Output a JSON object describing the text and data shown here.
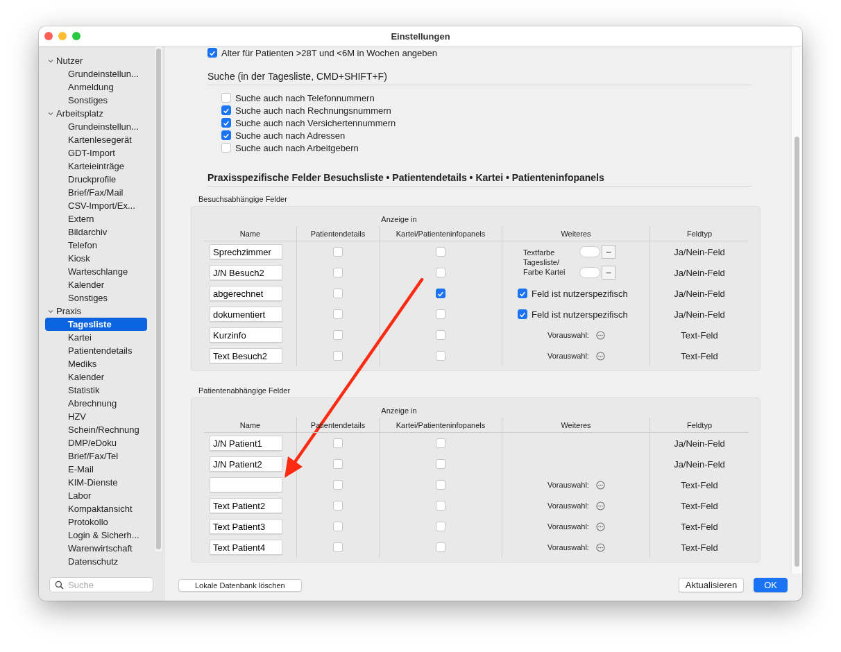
{
  "window": {
    "title": "Einstellungen"
  },
  "sidebar": {
    "items": [
      {
        "label": "Nutzer",
        "expanded": true,
        "selected": false,
        "children": [
          {
            "label": "Grundeinstellun...",
            "selected": false
          },
          {
            "label": "Anmeldung",
            "selected": false
          },
          {
            "label": "Sonstiges",
            "selected": false
          }
        ]
      },
      {
        "label": "Arbeitsplatz",
        "expanded": true,
        "selected": false,
        "children": [
          {
            "label": "Grundeinstellun...",
            "selected": false
          },
          {
            "label": "Kartenlesegerät",
            "selected": false
          },
          {
            "label": "GDT-Import",
            "selected": false
          },
          {
            "label": "Karteieinträge",
            "selected": false
          },
          {
            "label": "Druckprofile",
            "selected": false
          },
          {
            "label": "Brief/Fax/Mail",
            "selected": false
          },
          {
            "label": "CSV-Import/Ex...",
            "selected": false
          },
          {
            "label": "Extern",
            "selected": false
          },
          {
            "label": "Bildarchiv",
            "selected": false
          },
          {
            "label": "Telefon",
            "selected": false
          },
          {
            "label": "Kiosk",
            "selected": false
          },
          {
            "label": "Warteschlange",
            "selected": false
          },
          {
            "label": "Kalender",
            "selected": false
          },
          {
            "label": "Sonstiges",
            "selected": false
          }
        ]
      },
      {
        "label": "Praxis",
        "expanded": true,
        "selected": false,
        "children": [
          {
            "label": "Tagesliste",
            "selected": true
          },
          {
            "label": "Kartei",
            "selected": false
          },
          {
            "label": "Patientendetails",
            "selected": false
          },
          {
            "label": "Mediks",
            "selected": false
          },
          {
            "label": "Kalender",
            "selected": false
          },
          {
            "label": "Statistik",
            "selected": false
          },
          {
            "label": "Abrechnung",
            "selected": false
          },
          {
            "label": "HZV",
            "selected": false
          },
          {
            "label": "Schein/Rechnung",
            "selected": false
          },
          {
            "label": "DMP/eDoku",
            "selected": false
          },
          {
            "label": "Brief/Fax/Tel",
            "selected": false
          },
          {
            "label": "E-Mail",
            "selected": false
          },
          {
            "label": "KIM-Dienste",
            "selected": false
          },
          {
            "label": "Labor",
            "selected": false
          },
          {
            "label": "Kompaktansicht",
            "selected": false
          },
          {
            "label": "Protokollo",
            "selected": false
          },
          {
            "label": "Login & Sicherh...",
            "selected": false
          },
          {
            "label": "Warenwirtschaft",
            "selected": false
          },
          {
            "label": "Datenschutz",
            "selected": false
          }
        ]
      }
    ],
    "search": {
      "placeholder": "Suche"
    }
  },
  "top_option": {
    "label": "Alter für Patienten >28T und <6M in Wochen angeben",
    "checked": true
  },
  "search_section": {
    "title": "Suche (in der Tagesliste, CMD+SHIFT+F)",
    "options": [
      {
        "label": "Suche auch nach Telefonnummern",
        "checked": false
      },
      {
        "label": "Suche auch nach Rechnungsnummern",
        "checked": true
      },
      {
        "label": "Suche auch nach Versichertennummern",
        "checked": true
      },
      {
        "label": "Suche auch nach Adressen",
        "checked": true
      },
      {
        "label": "Suche auch nach Arbeitgebern",
        "checked": false
      }
    ]
  },
  "fields_section": {
    "title": "Praxisspezifische Felder Besuchsliste • Patientendetails • Kartei • Patienteninfopanels",
    "groups": [
      {
        "title": "Besuchsabhängige Felder",
        "group_header": "Anzeige in",
        "columns": [
          "Name",
          "Patientendetails",
          "Kartei/Patienteninfopanels",
          "Weiteres",
          "Feldtyp"
        ],
        "color_label": "Textfarbe Tagesliste/ Farbe Kartei",
        "rows": [
          {
            "name": "Sprechzimmer",
            "patientendetails": false,
            "kartei": false,
            "extra": {
              "kind": "color",
              "button": "–"
            },
            "type": "Ja/Nein-Feld"
          },
          {
            "name": "J/N Besuch2",
            "patientendetails": false,
            "kartei": false,
            "extra": {
              "kind": "color",
              "button": "–"
            },
            "type": "Ja/Nein-Feld"
          },
          {
            "name": "abgerechnet",
            "patientendetails": false,
            "kartei": true,
            "extra": {
              "kind": "checkbox",
              "label": "Feld ist nutzerspezifisch",
              "checked": true
            },
            "type": "Ja/Nein-Feld"
          },
          {
            "name": "dokumentiert",
            "patientendetails": false,
            "kartei": false,
            "extra": {
              "kind": "checkbox",
              "label": "Feld ist nutzerspezifisch",
              "checked": true
            },
            "type": "Ja/Nein-Feld"
          },
          {
            "name": "Kurzinfo",
            "patientendetails": false,
            "kartei": false,
            "extra": {
              "kind": "preselect",
              "label": "Vorauswahl:"
            },
            "type": "Text-Feld"
          },
          {
            "name": "Text Besuch2",
            "patientendetails": false,
            "kartei": false,
            "extra": {
              "kind": "preselect",
              "label": "Vorauswahl:"
            },
            "type": "Text-Feld"
          }
        ]
      },
      {
        "title": "Patientenabhängige Felder",
        "group_header": "Anzeige in",
        "columns": [
          "Name",
          "Patientendetails",
          "Kartei/Patienteninfopanels",
          "Weiteres",
          "Feldtyp"
        ],
        "rows": [
          {
            "name": "J/N Patient1",
            "patientendetails": false,
            "kartei": false,
            "extra": {
              "kind": "none"
            },
            "type": "Ja/Nein-Feld"
          },
          {
            "name": "J/N Patient2",
            "patientendetails": false,
            "kartei": false,
            "extra": {
              "kind": "none"
            },
            "type": "Ja/Nein-Feld"
          },
          {
            "name": "",
            "patientendetails": false,
            "kartei": false,
            "extra": {
              "kind": "preselect",
              "label": "Vorauswahl:"
            },
            "type": "Text-Feld"
          },
          {
            "name": "Text Patient2",
            "patientendetails": false,
            "kartei": false,
            "extra": {
              "kind": "preselect",
              "label": "Vorauswahl:"
            },
            "type": "Text-Feld"
          },
          {
            "name": "Text Patient3",
            "patientendetails": false,
            "kartei": false,
            "extra": {
              "kind": "preselect",
              "label": "Vorauswahl:"
            },
            "type": "Text-Feld"
          },
          {
            "name": "Text Patient4",
            "patientendetails": false,
            "kartei": false,
            "extra": {
              "kind": "preselect",
              "label": "Vorauswahl:"
            },
            "type": "Text-Feld"
          }
        ]
      }
    ]
  },
  "buttons": {
    "left": "Lokale Datenbank löschen",
    "right": [
      {
        "label": "Aktualisieren",
        "default": false
      },
      {
        "label": "OK",
        "default": true
      }
    ]
  }
}
